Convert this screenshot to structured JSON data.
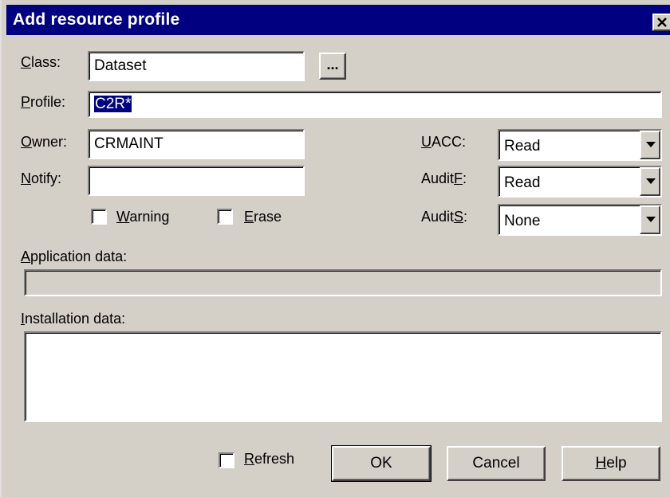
{
  "window": {
    "title": "Add resource profile",
    "close_glyph": "✕",
    "close_icon": "close-icon"
  },
  "form": {
    "class": {
      "label": "Class:",
      "value": "Dataset",
      "browse_label": "..."
    },
    "profile": {
      "label": "Profile:",
      "value": "C2R*"
    },
    "owner": {
      "label": "Owner:",
      "value": "CRMAINT"
    },
    "notify": {
      "label": "Notify:",
      "value": ""
    },
    "uacc": {
      "label": "UACC:",
      "value": "Read"
    },
    "auditf": {
      "label": "AuditF:",
      "value": "Read"
    },
    "audits": {
      "label": "AuditS:",
      "value": "None"
    },
    "warning": {
      "label": "Warning",
      "checked": false
    },
    "erase": {
      "label": "Erase",
      "checked": false
    },
    "application_data": {
      "label": "Application data:",
      "value": ""
    },
    "installation_data": {
      "label": "Installation data:",
      "value": ""
    }
  },
  "footer": {
    "refresh": {
      "label": "Refresh",
      "checked": false
    },
    "ok_label": "OK",
    "cancel_label": "Cancel",
    "help_label": "Help"
  },
  "colors": {
    "titlebar": "#000080",
    "face": "#d4d0c8",
    "selection": "#000080"
  }
}
